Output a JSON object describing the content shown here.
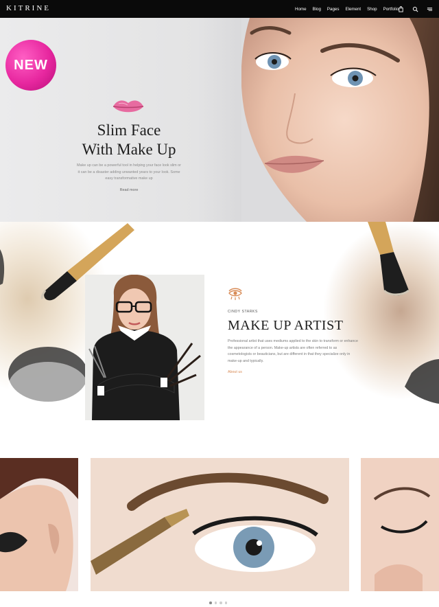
{
  "header": {
    "logo": "KITRINE",
    "nav": [
      "Home",
      "Blog",
      "Pages",
      "Element",
      "Shop",
      "Portfolio"
    ],
    "icons": [
      "cart-icon",
      "search-icon",
      "menu-icon"
    ]
  },
  "hero": {
    "badge": "NEW",
    "title_line1": "Slim Face",
    "title_line2": "With Make Up",
    "text": "Make up can be a powerful tool in helping your face look slim or it can be a disaster adding unwanted years to your look. Some easy transformative make up",
    "link": "Read more"
  },
  "artist": {
    "label": "CINDY STARKS",
    "title": "MAKE UP ARTIST",
    "text": "Professional artist that uses mediums applied to the skin to transform or enhance the appearance of a person. Make-up artists are often referred to as cosmetologists or beauticians, but are different in that they specialize only in make-up and typically.",
    "link": "About us"
  },
  "colors": {
    "accent": "#d88b56",
    "badge": "#e7279f",
    "header_bg": "#0a0a0a"
  },
  "gallery": {
    "slides": 4,
    "active_slide": 1
  }
}
